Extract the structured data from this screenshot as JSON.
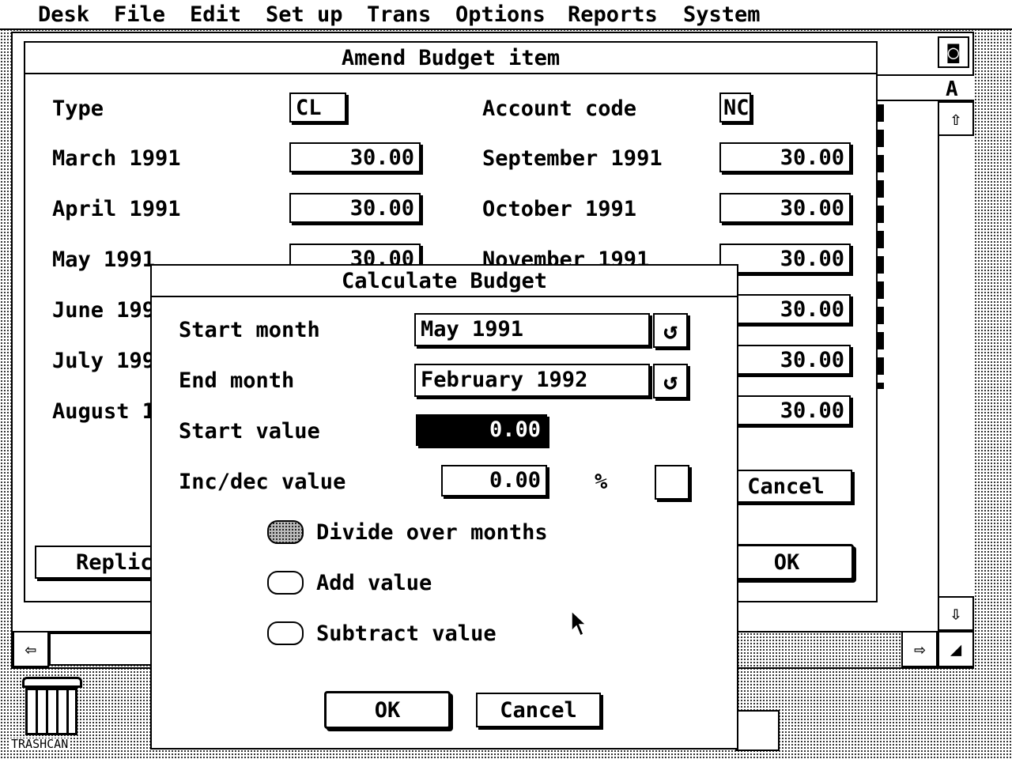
{
  "menubar": {
    "items": [
      "Desk",
      "File",
      "Edit",
      "Set up",
      "Trans",
      "Options",
      "Reports",
      "System"
    ]
  },
  "desktop": {
    "trash_label": "TRASHCAN"
  },
  "background_window": {
    "header_letter": "A"
  },
  "amend_dialog": {
    "title": "Amend Budget item",
    "type_label": "Type",
    "type_value": "CL",
    "account_code_label": "Account code",
    "account_code_value": "NC",
    "months_left": [
      {
        "label": "March 1991",
        "value": "30.00"
      },
      {
        "label": "April 1991",
        "value": "30.00"
      },
      {
        "label": "May 1991",
        "value": "30.00"
      },
      {
        "label": "June 199",
        "value": ""
      },
      {
        "label": "July 199",
        "value": ""
      },
      {
        "label": "August 1",
        "value": ""
      }
    ],
    "months_right": [
      {
        "label": "September 1991",
        "value": "30.00"
      },
      {
        "label": "October 1991",
        "value": "30.00"
      },
      {
        "label": "November 1991",
        "value": "30.00"
      },
      {
        "label": "",
        "value": "30.00"
      },
      {
        "label": "",
        "value": "30.00"
      },
      {
        "label": "",
        "value": "30.00"
      }
    ],
    "replicate_label": "Replic",
    "cancel_label": "Cancel",
    "ok_label": "OK"
  },
  "calc_dialog": {
    "title": "Calculate Budget",
    "start_month_label": "Start month",
    "start_month_value": "May 1991",
    "end_month_label": "End month",
    "end_month_value": "February 1992",
    "start_value_label": "Start value",
    "start_value": "0.00",
    "incdec_label": "Inc/dec value",
    "incdec_value": "0.00",
    "percent_label": "%",
    "options": [
      {
        "label": "Divide over months",
        "selected": true
      },
      {
        "label": "Add value",
        "selected": false
      },
      {
        "label": "Subtract value",
        "selected": false
      }
    ],
    "ok_label": "OK",
    "cancel_label": "Cancel"
  }
}
